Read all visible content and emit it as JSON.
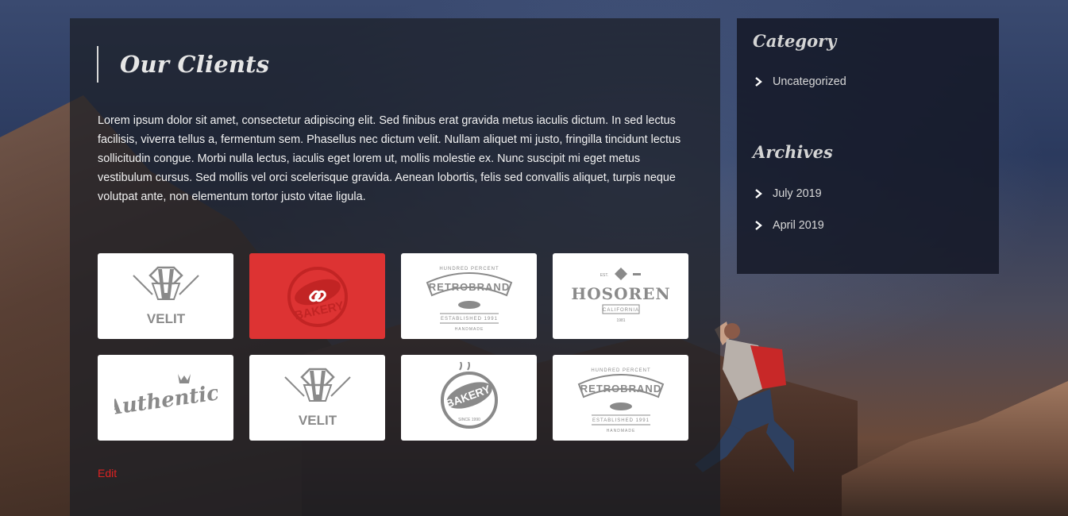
{
  "page": {
    "title": "Our Clients",
    "intro": "Lorem ipsum dolor sit amet, consectetur adipiscing elit. Sed finibus erat gravida metus iaculis dictum. In sed lectus facilisis, viverra tellus a, fermentum sem. Phasellus nec dictum velit. Nullam aliquet mi justo, fringilla tincidunt lectus sollicitudin congue. Morbi nulla lectus, iaculis eget lorem ut, mollis molestie ex. Nunc suscipit mi eget metus vestibulum cursus. Sed mollis vel orci scelerisque gravida. Aenean lobortis, felis sed convallis aliquet, turpis neque volutpat ante, non elementum tortor justo vitae ligula.",
    "edit_label": "Edit",
    "accent_color": "#dd3333"
  },
  "clients": [
    {
      "name": "VELIT",
      "icon": "velit-logo"
    },
    {
      "name": "BAKERY",
      "icon": "bakery-logo",
      "active": true,
      "overlay_icon": "link-icon"
    },
    {
      "name": "RETROBRAND",
      "top": "HUNDRED PERCENT",
      "bottom": "ESTABLISHED 1991",
      "foot": "HANDMADE",
      "icon": "retrobrand-logo"
    },
    {
      "name": "HOSOREN",
      "top": "EST.",
      "sub": "CALIFORNIA",
      "foot": "1981",
      "icon": "hosoren-logo"
    },
    {
      "name": "Authentic",
      "icon": "authentic-logo"
    },
    {
      "name": "VELIT",
      "icon": "velit-logo"
    },
    {
      "name": "BAKERY",
      "foot": "SINCE 1990",
      "icon": "bakery-logo"
    },
    {
      "name": "RETROBRAND",
      "top": "HUNDRED PERCENT",
      "bottom": "ESTABLISHED 1991",
      "foot": "HANDMADE",
      "icon": "retrobrand-logo"
    }
  ],
  "sidebar": {
    "category_title": "Category",
    "categories": [
      {
        "label": "Uncategorized"
      }
    ],
    "archives_title": "Archives",
    "archives": [
      {
        "label": "July 2019"
      },
      {
        "label": "April 2019"
      }
    ]
  }
}
